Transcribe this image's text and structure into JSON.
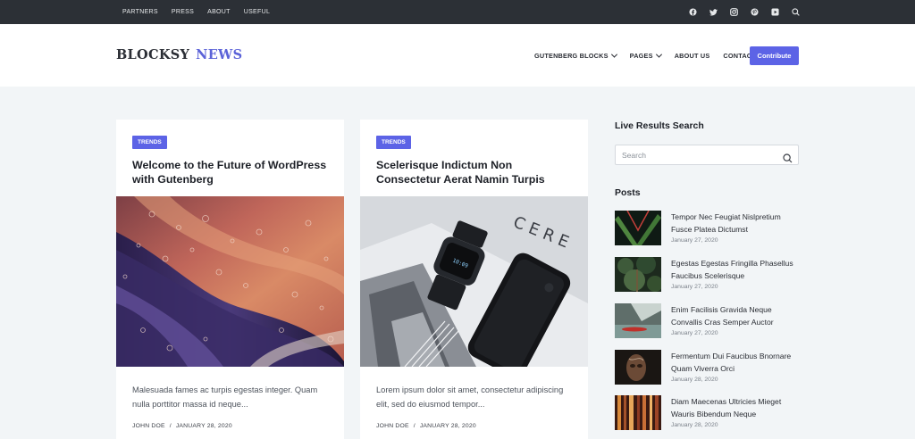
{
  "topbar": {
    "menu": [
      "PARTNERS",
      "PRESS",
      "ABOUT",
      "USEFUL"
    ],
    "socials": [
      "facebook-icon",
      "twitter-icon",
      "instagram-icon",
      "pinterest-icon",
      "youtube-icon",
      "search-icon"
    ]
  },
  "header": {
    "logo_part1": "BLOCKSY",
    "logo_part2": "NEWS",
    "nav": [
      "GUTENBERG BLOCKS",
      "PAGES",
      "ABOUT US",
      "CONTACT"
    ],
    "cta": "Contribute"
  },
  "colors": {
    "accent": "#5c63e6",
    "topbar_bg": "#2c3036",
    "page_bg": "#f2f5f7"
  },
  "cards": [
    {
      "badge": "TRENDS",
      "title": "Welcome to the Future of WordPress with Gutenberg",
      "excerpt": "Malesuada fames ac turpis egestas integer. Quam nulla porttitor massa id neque...",
      "author": "JOHN DOE",
      "separator": "/",
      "date": "JANUARY 28, 2020"
    },
    {
      "badge": "TRENDS",
      "title": "Scelerisque Indictum Non Consectetur Aerat Namin Turpis",
      "excerpt": "Lorem ipsum dolor sit amet, consectetur adipiscing elit, sed do eiusmod tempor...",
      "author": "JOHN DOE",
      "separator": "/",
      "date": "JANUARY 28, 2020"
    }
  ],
  "sidebar": {
    "search_heading": "Live Results Search",
    "search_placeholder": "Search",
    "posts_heading": "Posts",
    "posts": [
      {
        "title": "Tempor Nec Feugiat Nislpretium Fusce Platea Dictumst",
        "date": "January 27, 2020"
      },
      {
        "title": "Egestas Egestas Fringilla Phasellus Faucibus Scelerisque",
        "date": "January 27, 2020"
      },
      {
        "title": "Enim Facilisis Gravida Neque Convallis Cras Semper Auctor",
        "date": "January 27, 2020"
      },
      {
        "title": "Fermentum Dui Faucibus Bnornare Quam Viverra Orci",
        "date": "January 28, 2020"
      },
      {
        "title": "Diam Maecenas Ultricies Mieget Wauris Bibendum Neque",
        "date": "January 28, 2020"
      }
    ]
  }
}
